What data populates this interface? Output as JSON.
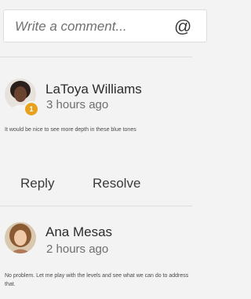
{
  "composer": {
    "placeholder": "Write a comment...",
    "mention_symbol": "@"
  },
  "comments": [
    {
      "author": "LaToya Williams",
      "time": "3 hours ago",
      "text": "It would be nice to see more depth in these blue tones",
      "badge": "1",
      "badge_color": "#e8a11f",
      "actions": {
        "reply": "Reply",
        "resolve": "Resolve"
      }
    },
    {
      "author": "Ana Mesas",
      "time": "2 hours ago",
      "text": "No problem. Let me play with the levels and see what we can do to address that."
    }
  ]
}
